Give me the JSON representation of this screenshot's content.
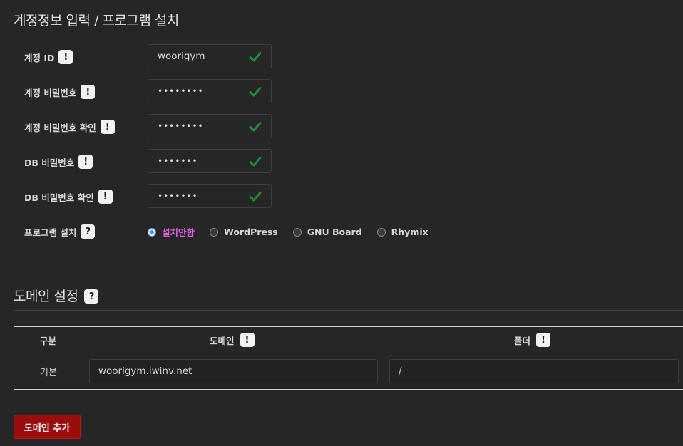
{
  "account_section": {
    "title": "계정정보 입력 / 프로그램 설치",
    "fields": [
      {
        "label": "계정 ID",
        "badge": "!",
        "value": "woorigym",
        "masked": false,
        "valid": true
      },
      {
        "label": "계정 비밀번호",
        "badge": "!",
        "value": "••••••••",
        "masked": true,
        "valid": true
      },
      {
        "label": "계정 비밀번호 확인",
        "badge": "!",
        "value": "••••••••",
        "masked": true,
        "valid": true
      },
      {
        "label": "DB 비밀번호",
        "badge": "!",
        "value": "•••••••",
        "masked": true,
        "valid": true
      },
      {
        "label": "DB 비밀번호 확인",
        "badge": "!",
        "value": "•••••••",
        "masked": true,
        "valid": true
      }
    ],
    "program": {
      "label": "프로그램 설치",
      "badge": "?",
      "options": [
        {
          "label": "설치안함",
          "checked": true
        },
        {
          "label": "WordPress",
          "checked": false
        },
        {
          "label": "GNU Board",
          "checked": false
        },
        {
          "label": "Rhymix",
          "checked": false
        }
      ]
    }
  },
  "domain_section": {
    "title": "도메인 설정",
    "badge": "?",
    "table": {
      "headers": {
        "type": "구분",
        "domain": "도메인",
        "domain_badge": "!",
        "folder": "폴더",
        "folder_badge": "!"
      },
      "rows": [
        {
          "type": "기본",
          "domain": "woorigym.iwinv.net",
          "folder": "/"
        }
      ]
    },
    "add_button": "도메인 추가"
  },
  "colors": {
    "background": "#262626",
    "check": "#1e8a3e",
    "selected_radio_text": "#e45ce4",
    "add_button": "#9b0d0d"
  }
}
